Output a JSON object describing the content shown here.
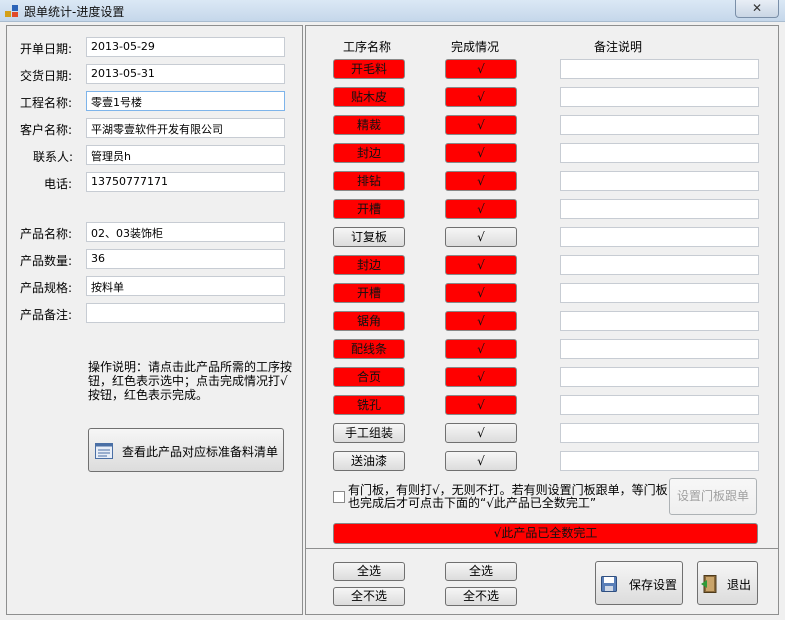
{
  "window": {
    "title": "跟单统计-进度设置",
    "close_glyph": "✕"
  },
  "left": {
    "labels": {
      "open_date": "开单日期:",
      "delivery_date": "交货日期:",
      "project_name": "工程名称:",
      "customer_name": "客户名称:",
      "contact": "联系人:",
      "phone": "电话:",
      "product_name": "产品名称:",
      "product_qty": "产品数量:",
      "product_spec": "产品规格:",
      "product_note": "产品备注:"
    },
    "values": {
      "open_date": "2013-05-29",
      "delivery_date": "2013-05-31",
      "project_name": "零壹1号楼",
      "customer_name": "平湖零壹软件开发有限公司",
      "contact": "管理员h",
      "phone": "13750777171",
      "product_name": "02、03装饰柜",
      "product_qty": "36",
      "product_spec": "按料单",
      "product_note": ""
    },
    "instructions": "操作说明：请点击此产品所需的工序按钮，红色表示选中；点击完成情况打√按钮，红色表示完成。",
    "material_button": "查看此产品对应标准备料清单"
  },
  "right": {
    "headers": {
      "process": "工序名称",
      "status": "完成情况",
      "note": "备注说明"
    },
    "rows": [
      {
        "process": "开毛料",
        "status": "√",
        "selected": true,
        "done": true
      },
      {
        "process": "贴木皮",
        "status": "√",
        "selected": true,
        "done": true
      },
      {
        "process": "精裁",
        "status": "√",
        "selected": true,
        "done": true
      },
      {
        "process": "封边",
        "status": "√",
        "selected": true,
        "done": true
      },
      {
        "process": "排钻",
        "status": "√",
        "selected": true,
        "done": true
      },
      {
        "process": "开槽",
        "status": "√",
        "selected": true,
        "done": true
      },
      {
        "process": "订复板",
        "status": "√",
        "selected": false,
        "done": false
      },
      {
        "process": "封边",
        "status": "√",
        "selected": true,
        "done": true
      },
      {
        "process": "开槽",
        "status": "√",
        "selected": true,
        "done": true
      },
      {
        "process": "锯角",
        "status": "√",
        "selected": true,
        "done": true
      },
      {
        "process": "配线条",
        "status": "√",
        "selected": true,
        "done": true
      },
      {
        "process": "合页",
        "status": "√",
        "selected": true,
        "done": true
      },
      {
        "process": "铣孔",
        "status": "√",
        "selected": true,
        "done": true
      },
      {
        "process": "手工组装",
        "status": "√",
        "selected": false,
        "done": false
      },
      {
        "process": "送油漆",
        "status": "√",
        "selected": false,
        "done": false
      }
    ],
    "door_checkbox_text": "有门板，有则打√，无则不打。若有则设置门板跟单，等门板也完成后才可点击下面的“√此产品已全数完工”",
    "door_button": "设置门板跟单",
    "complete_button": "√此产品已全数完工"
  },
  "bottom": {
    "select_all_process": "全选",
    "deselect_all_process": "全不选",
    "select_all_status": "全选",
    "deselect_all_status": "全不选",
    "save": "保存设置",
    "exit": "退出"
  },
  "colors": {
    "selected_red": "#ff0000",
    "window_bg": "#f0f0f0"
  }
}
